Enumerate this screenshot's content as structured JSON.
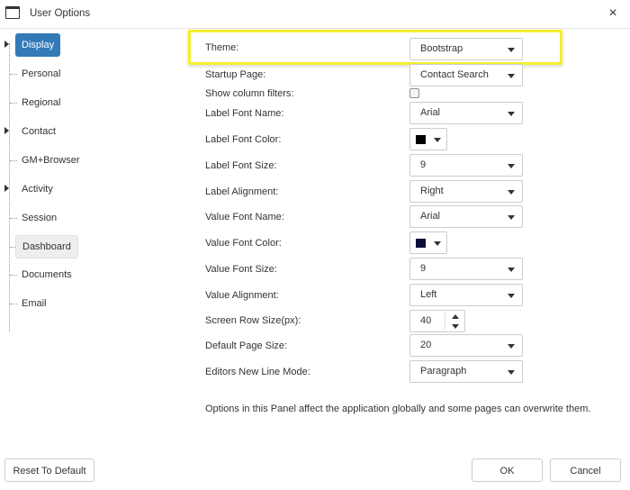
{
  "window": {
    "title": "User Options",
    "close_glyph": "×"
  },
  "tree": {
    "items": [
      {
        "label": "Display",
        "expandable": true,
        "state": "selected"
      },
      {
        "label": "Personal",
        "expandable": false
      },
      {
        "label": "Regional",
        "expandable": false
      },
      {
        "label": "Contact",
        "expandable": true
      },
      {
        "label": "GM+Browser",
        "expandable": false
      },
      {
        "label": "Activity",
        "expandable": true
      },
      {
        "label": "Session",
        "expandable": false
      },
      {
        "label": "Dashboard",
        "expandable": false,
        "state": "hover"
      },
      {
        "label": "Documents",
        "expandable": false
      },
      {
        "label": "Email",
        "expandable": false
      }
    ]
  },
  "form": {
    "theme": {
      "label": "Theme:",
      "value": "Bootstrap"
    },
    "startup_page": {
      "label": "Startup Page:",
      "value": "Contact Search"
    },
    "show_column_filters": {
      "label": "Show column filters:",
      "checked": false
    },
    "label_font_name": {
      "label": "Label Font Name:",
      "value": "Arial"
    },
    "label_font_color": {
      "label": "Label Font Color:",
      "color": "#000000"
    },
    "label_font_size": {
      "label": "Label Font Size:",
      "value": "9"
    },
    "label_alignment": {
      "label": "Label Alignment:",
      "value": "Right"
    },
    "value_font_name": {
      "label": "Value Font Name:",
      "value": "Arial"
    },
    "value_font_color": {
      "label": "Value Font Color:",
      "color": "#0d0d3a"
    },
    "value_font_size": {
      "label": "Value Font Size:",
      "value": "9"
    },
    "value_alignment": {
      "label": "Value Alignment:",
      "value": "Left"
    },
    "screen_row_size": {
      "label": "Screen Row Size(px):",
      "value": "40"
    },
    "default_page_size": {
      "label": "Default Page Size:",
      "value": "20"
    },
    "editors_new_line_mode": {
      "label": "Editors New Line Mode:",
      "value": "Paragraph"
    }
  },
  "note": "Options in this Panel affect the application globally and some pages can overwrite them.",
  "buttons": {
    "reset": "Reset To Default",
    "ok": "OK",
    "cancel": "Cancel"
  },
  "colors": {
    "accent": "#337ab7",
    "highlight_border": "#f5ee2d"
  }
}
